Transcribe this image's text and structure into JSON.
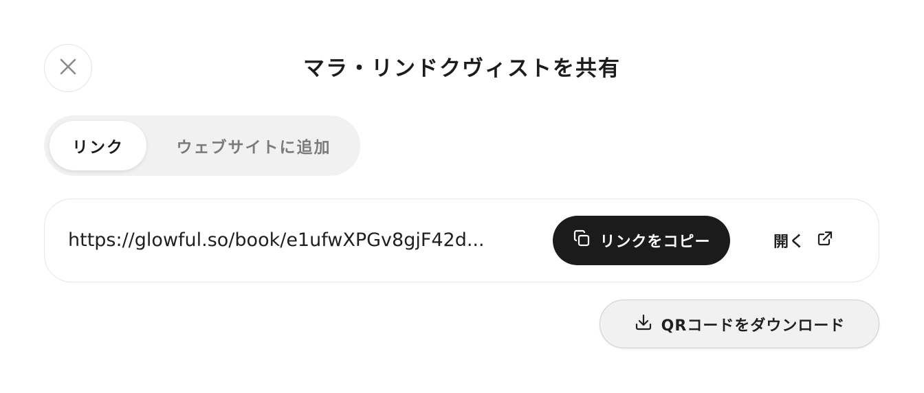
{
  "dialog": {
    "title": "マラ・リンドクヴィストを共有",
    "close_icon": "close-icon"
  },
  "tabs": [
    {
      "label": "リンク",
      "active": true
    },
    {
      "label": "ウェブサイトに追加",
      "active": false
    }
  ],
  "share_link": {
    "url": "https://glowful.so/book/e1ufwXPGv8gjF42d...",
    "copy_label": "リンクをコピー",
    "copy_icon": "copy-icon",
    "open_label": "開く",
    "open_icon": "external-link-icon"
  },
  "qr": {
    "download_label": "QRコードをダウンロード",
    "download_icon": "download-icon"
  },
  "colors": {
    "primary_button": "#1b1b1b",
    "tab_track": "#f1f1f1",
    "inactive_tab_text": "#7a7a7a"
  }
}
